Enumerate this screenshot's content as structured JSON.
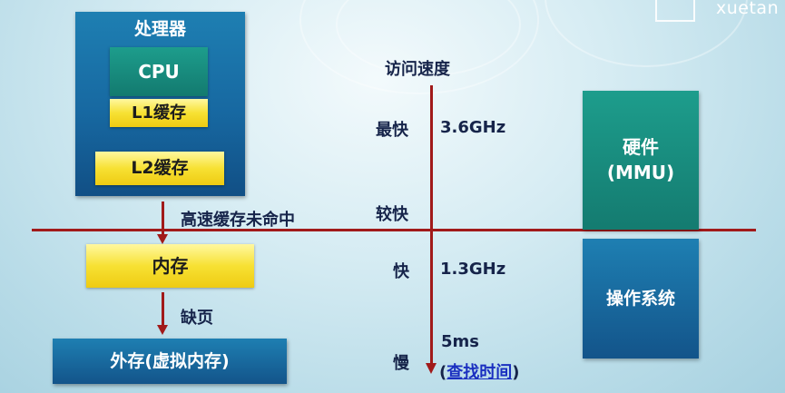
{
  "logo": {
    "text": "xuetan"
  },
  "processor": {
    "title": "处理器",
    "core_label": "CPU",
    "l1_label": "L1缓存",
    "l2_label": "L2缓存"
  },
  "memory_label": "内存",
  "storage_label": "外存(虚拟内存)",
  "cache_miss_label": "高速缓存未命中",
  "page_fault_label": "缺页",
  "speed_axis": {
    "title": "访问速度",
    "levels": [
      {
        "name": "最快",
        "value": "3.6GHz"
      },
      {
        "name": "较快",
        "value": ""
      },
      {
        "name": "快",
        "value": "1.3GHz"
      },
      {
        "name": "慢",
        "value": "5ms"
      }
    ],
    "slow_note_open": "(",
    "slow_note_link": "查找时间",
    "slow_note_close": ")"
  },
  "hardware": {
    "line1": "硬件",
    "line2": "(MMU)"
  },
  "os_label": "操作系统",
  "colors": {
    "blue_box": "#1768a1",
    "teal_box": "#147b70",
    "yellow_box": "#f7e133",
    "red_line": "#a11a1a",
    "link_blue": "#1a2fc0"
  }
}
